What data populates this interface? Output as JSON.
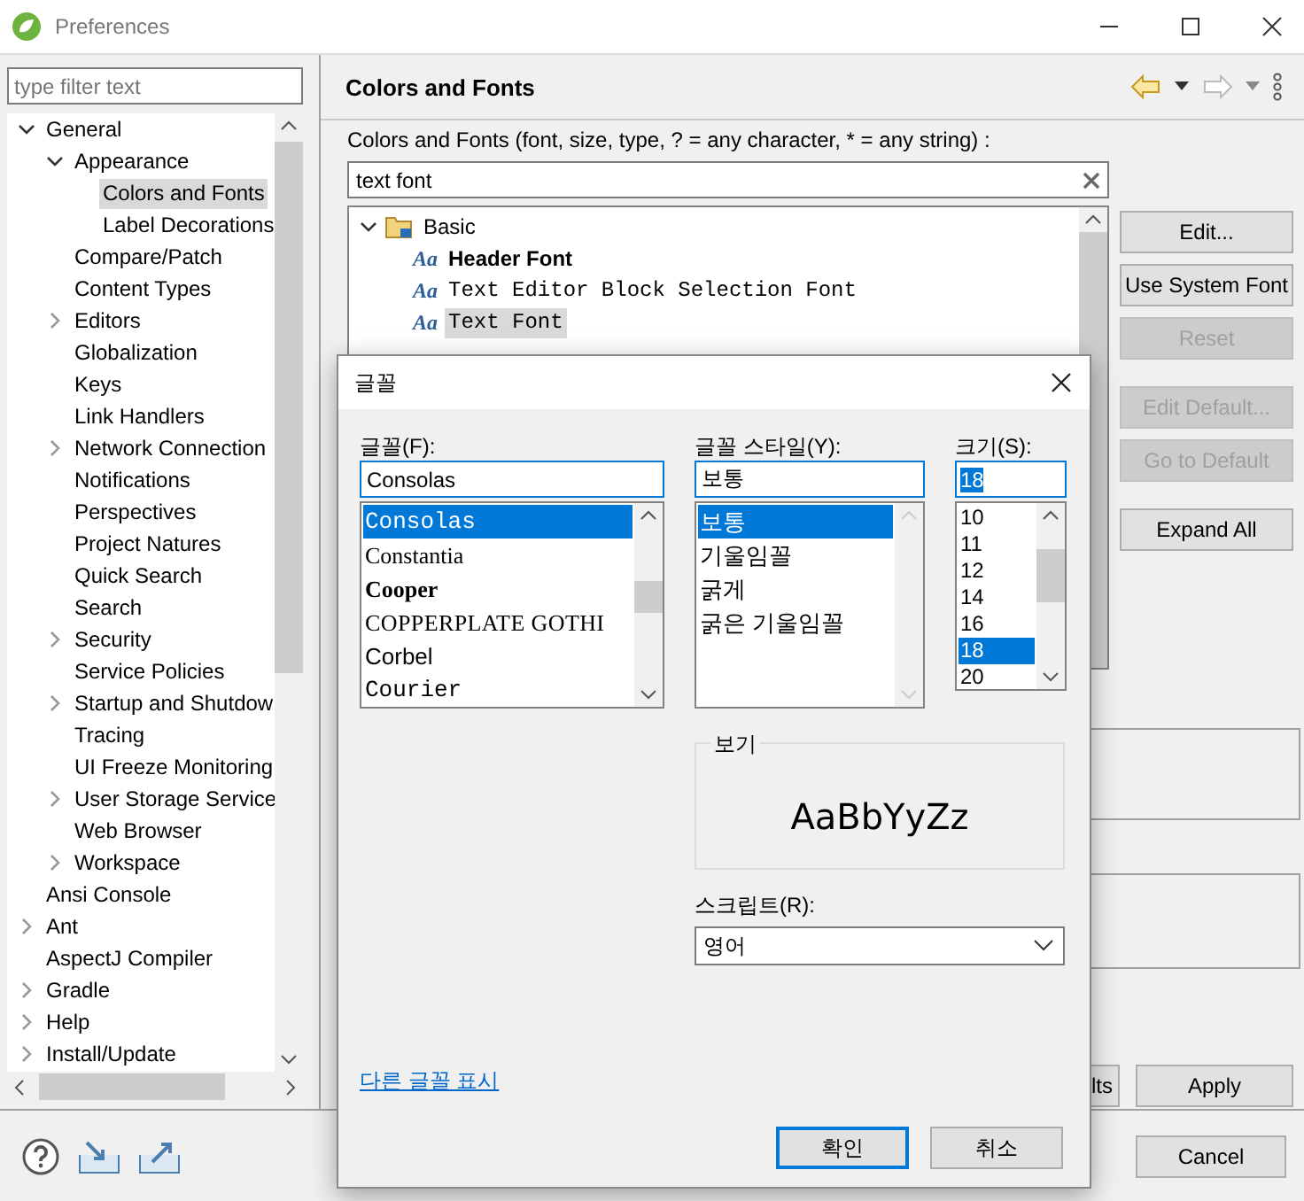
{
  "window": {
    "title": "Preferences"
  },
  "sidebar": {
    "filter": {
      "placeholder": "type filter text"
    },
    "tree": [
      {
        "label": "General",
        "expanded": true,
        "selected": false,
        "children": [
          {
            "label": "Appearance",
            "expanded": true,
            "selected": false,
            "children": [
              {
                "label": "Colors and Fonts",
                "selected": true
              },
              {
                "label": "Label Decorations",
                "selected": false
              }
            ]
          },
          {
            "label": "Compare/Patch",
            "selected": false
          },
          {
            "label": "Content Types",
            "selected": false
          },
          {
            "label": "Editors",
            "expanded": false,
            "selected": false
          },
          {
            "label": "Globalization",
            "selected": false
          },
          {
            "label": "Keys",
            "selected": false
          },
          {
            "label": "Link Handlers",
            "selected": false
          },
          {
            "label": "Network Connection",
            "expanded": false,
            "selected": false
          },
          {
            "label": "Notifications",
            "selected": false
          },
          {
            "label": "Perspectives",
            "selected": false
          },
          {
            "label": "Project Natures",
            "selected": false
          },
          {
            "label": "Quick Search",
            "selected": false
          },
          {
            "label": "Search",
            "selected": false
          },
          {
            "label": "Security",
            "expanded": false,
            "selected": false
          },
          {
            "label": "Service Policies",
            "selected": false
          },
          {
            "label": "Startup and Shutdow",
            "expanded": false,
            "selected": false
          },
          {
            "label": "Tracing",
            "selected": false
          },
          {
            "label": "UI Freeze Monitoring",
            "selected": false
          },
          {
            "label": "User Storage Service",
            "expanded": false,
            "selected": false
          },
          {
            "label": "Web Browser",
            "selected": false
          },
          {
            "label": "Workspace",
            "expanded": false,
            "selected": false
          }
        ]
      },
      {
        "label": "Ansi Console",
        "selected": false
      },
      {
        "label": "Ant",
        "expanded": false,
        "selected": false
      },
      {
        "label": "AspectJ Compiler",
        "selected": false
      },
      {
        "label": "Gradle",
        "expanded": false,
        "selected": false
      },
      {
        "label": "Help",
        "expanded": false,
        "selected": false
      },
      {
        "label": "Install/Update",
        "expanded": false,
        "selected": false
      }
    ]
  },
  "page": {
    "title": "Colors and Fonts",
    "filter_label": "Colors and Fonts (font, size, type, ? = any character, * = any string) :",
    "filter": {
      "value": "text font"
    },
    "tree": [
      {
        "label": "Basic",
        "kind": "category",
        "expanded": true,
        "selected": false,
        "children": [
          {
            "label": "Header Font",
            "kind": "bold",
            "glyph": "Aa",
            "selected": false
          },
          {
            "label": "Text Editor Block Selection Font",
            "kind": "mono",
            "glyph": "Aa",
            "selected": false
          },
          {
            "label": "Text Font",
            "kind": "mono",
            "glyph": "Aa",
            "selected": true
          }
        ]
      }
    ],
    "buttons": [
      {
        "label": "Edit...",
        "disabled": false
      },
      {
        "label": "Use System Font",
        "disabled": false
      },
      {
        "label": "Reset",
        "disabled": true
      },
      {
        "label": "Edit Default...",
        "disabled": true
      },
      {
        "label": "Go to Default",
        "disabled": true
      },
      {
        "label": "Expand All",
        "disabled": false
      }
    ],
    "footer_buttons": [
      {
        "label": "lts"
      },
      {
        "label": "Apply"
      }
    ]
  },
  "bottom_buttons": [
    {
      "label": "Cancel"
    }
  ],
  "dialog": {
    "title": "글꼴",
    "font": {
      "label": "글꼴(F):",
      "value": "Consolas",
      "options": [
        {
          "label": "Consolas",
          "kind": "mono",
          "selected": true
        },
        {
          "label": "Constantia",
          "kind": "serif",
          "selected": false
        },
        {
          "label": "Cooper",
          "kind": "heavy",
          "selected": false
        },
        {
          "label": "COPPERPLATE GOTHI",
          "kind": "wide",
          "selected": false
        },
        {
          "label": "Corbel",
          "kind": "sans",
          "selected": false
        },
        {
          "label": "Courier",
          "kind": "mono",
          "selected": false
        }
      ]
    },
    "style": {
      "label": "글꼴 스타일(Y):",
      "value": "보통",
      "options": [
        {
          "label": "보통",
          "selected": true
        },
        {
          "label": "기울임꼴",
          "selected": false
        },
        {
          "label": "굵게",
          "selected": false
        },
        {
          "label": "굵은 기울임꼴",
          "selected": false
        }
      ]
    },
    "size": {
      "label": "크기(S):",
      "value": "18",
      "options": [
        {
          "label": "10",
          "selected": false
        },
        {
          "label": "11",
          "selected": false
        },
        {
          "label": "12",
          "selected": false
        },
        {
          "label": "14",
          "selected": false
        },
        {
          "label": "16",
          "selected": false
        },
        {
          "label": "18",
          "selected": true
        },
        {
          "label": "20",
          "selected": false
        }
      ]
    },
    "preview": {
      "label": "보기",
      "sample": "AaBbYyZz"
    },
    "script": {
      "label": "스크립트(R):",
      "value": "영어"
    },
    "link": "다른 글꼴 표시",
    "buttons": [
      {
        "label": "확인",
        "default": true
      },
      {
        "label": "취소",
        "default": false
      }
    ]
  }
}
